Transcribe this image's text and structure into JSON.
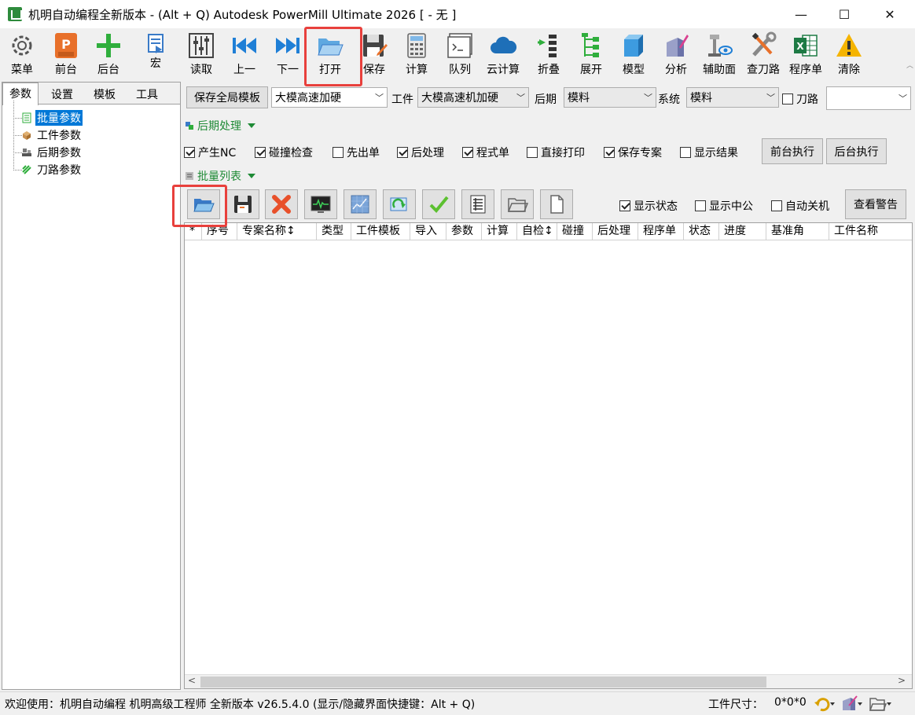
{
  "window": {
    "title": "机明自动编程全新版本 - (Alt + Q) Autodesk PowerMill Ultimate 2026    [  - 无 ]",
    "controls": {
      "minimize": "—",
      "maximize": "☐",
      "close": "✕"
    }
  },
  "toolbar": {
    "items": [
      {
        "label": "菜单",
        "icon": "gear-icon"
      },
      {
        "label": "前台",
        "icon": "powermill-icon"
      },
      {
        "label": "后台",
        "icon": "plus-icon"
      },
      {
        "label": "宏",
        "icon": "macro-icon"
      },
      {
        "label": "读取",
        "icon": "sliders-icon"
      },
      {
        "label": "上一",
        "icon": "skip-back-icon"
      },
      {
        "label": "下一",
        "icon": "skip-forward-icon"
      },
      {
        "label": "打开",
        "icon": "folder-open-icon",
        "highlighted": true
      },
      {
        "label": "保存",
        "icon": "save-icon"
      },
      {
        "label": "计算",
        "icon": "calculator-icon"
      },
      {
        "label": "队列",
        "icon": "terminal-icon"
      },
      {
        "label": "云计算",
        "icon": "cloud-icon"
      },
      {
        "label": "折叠",
        "icon": "collapse-icon"
      },
      {
        "label": "展开",
        "icon": "expand-tree-icon"
      },
      {
        "label": "模型",
        "icon": "cube-icon"
      },
      {
        "label": "分析",
        "icon": "analysis-icon"
      },
      {
        "label": "辅助面",
        "icon": "surface-icon"
      },
      {
        "label": "查刀路",
        "icon": "tools-icon"
      },
      {
        "label": "程序单",
        "icon": "excel-icon"
      },
      {
        "label": "清除",
        "icon": "warning-icon"
      }
    ]
  },
  "left_panel": {
    "tabs": [
      "参数",
      "设置",
      "模板",
      "工具"
    ],
    "active_tab": "参数",
    "tree": [
      {
        "label": "批量参数",
        "selected": true,
        "icon": "batch-icon"
      },
      {
        "label": "工件参数",
        "selected": false,
        "icon": "box-icon"
      },
      {
        "label": "后期参数",
        "selected": false,
        "icon": "machine-icon"
      },
      {
        "label": "刀路参数",
        "selected": false,
        "icon": "toolpath-icon"
      }
    ]
  },
  "template_bar": {
    "save_button": "保存全局模板",
    "template_value": "大模高速加硬",
    "workpiece_label": "工件",
    "workpiece_value": "大模高速机加硬",
    "post_label": "后期",
    "post_value": "模料",
    "system_label": "系统",
    "system_value": "模料",
    "toolpath_label": "刀路",
    "toolpath_checked": false,
    "toolpath_value": ""
  },
  "post_section": {
    "title": "后期处理",
    "options": [
      {
        "label": "产生NC",
        "checked": true
      },
      {
        "label": "碰撞检查",
        "checked": true
      },
      {
        "label": "先出单",
        "checked": false
      },
      {
        "label": "后处理",
        "checked": true
      },
      {
        "label": "程式单",
        "checked": true
      },
      {
        "label": "直接打印",
        "checked": false
      },
      {
        "label": "保存专案",
        "checked": true
      },
      {
        "label": "显示结果",
        "checked": false
      }
    ],
    "front_exec": "前台执行",
    "back_exec": "后台执行"
  },
  "batch_section": {
    "title": "批量列表",
    "tool_icons": [
      "folder-open-icon",
      "save-icon",
      "delete-icon",
      "monitor-icon",
      "chart-icon",
      "refresh-icon",
      "check-icon",
      "list-icon",
      "folder-icon",
      "document-icon"
    ],
    "show_status": {
      "label": "显示状态",
      "checked": true
    },
    "show_center": {
      "label": "显示中公",
      "checked": false
    },
    "auto_shutdown": {
      "label": "自动关机",
      "checked": false
    },
    "view_warnings": "查看警告"
  },
  "grid": {
    "columns": [
      "*",
      "序号",
      "专案名称↕",
      "类型",
      "工件模板",
      "导入",
      "参数",
      "计算",
      "自检↕",
      "碰撞",
      "后处理",
      "程序单",
      "状态",
      "进度",
      "基准角",
      "工件名称"
    ],
    "rows": []
  },
  "status_bar": {
    "message": "欢迎使用：机明自动编程 机明高级工程师 全新版本 v26.5.4.0  (显示/隐藏界面快捷键：Alt + Q)",
    "size_label": "工件尺寸：",
    "size_value": "0*0*0"
  },
  "colors": {
    "highlight": "#e8403c",
    "accent": "#0078d7",
    "section": "#1e8a35"
  }
}
